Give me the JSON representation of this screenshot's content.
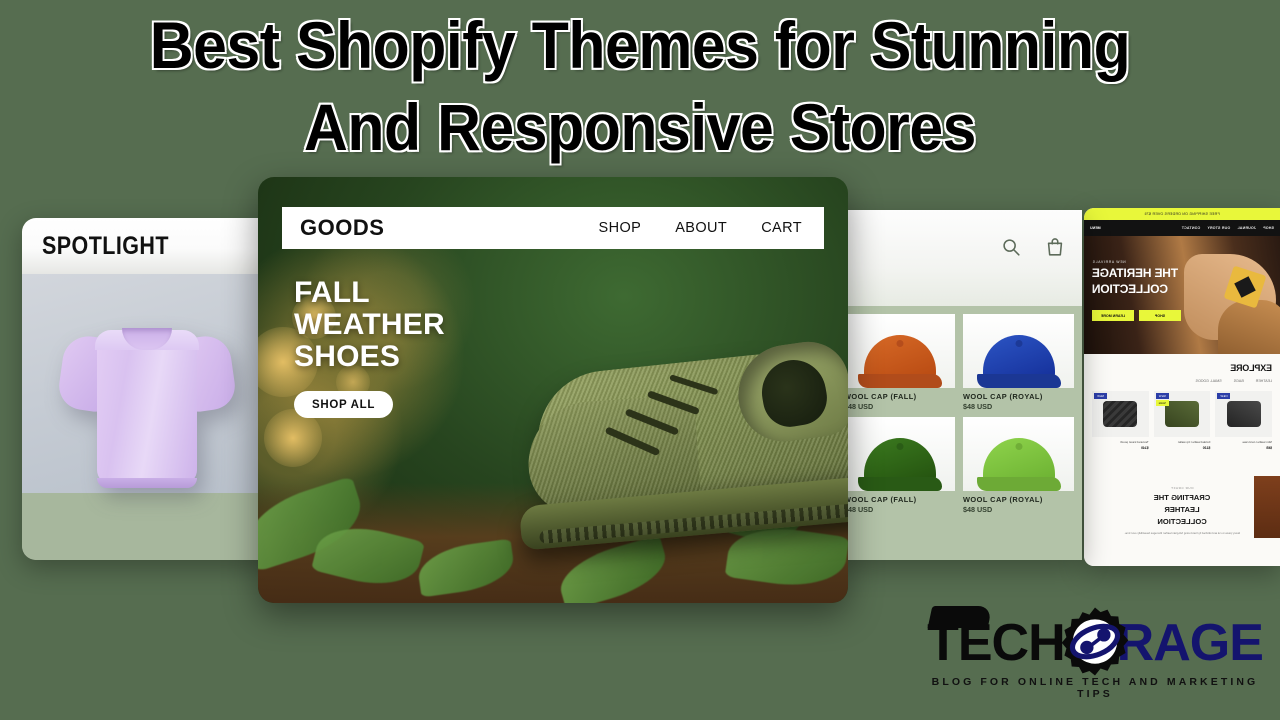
{
  "page": {
    "background_color": "#566d50",
    "title_lines": [
      "Best Shopify Themes for Stunning",
      "And Responsive Stores"
    ]
  },
  "left_card": {
    "name": "spotlight-theme-card",
    "header_label": "SPOTLIGHT",
    "product_alt": "lavender t-shirt",
    "header_bg": "#ffffff",
    "stage_bg": "#c6ccd4",
    "footer_bg": "#a7b79d"
  },
  "center_card": {
    "name": "goods-theme-card",
    "brand": "GOODS",
    "nav": [
      "SHOP",
      "ABOUT",
      "CART"
    ],
    "headline": [
      "FALL",
      "WEATHER",
      "SHOES"
    ],
    "cta": "SHOP ALL",
    "product_alt": "olive green knit sneaker",
    "bg_color": "#27451f"
  },
  "right_card": {
    "name": "wool-cap-grid-card",
    "icons": [
      "search-icon",
      "shopping-bag-icon"
    ],
    "products": [
      {
        "name": "WOOL CAP (FALL)",
        "price": "$48 USD",
        "color": "#c9561f"
      },
      {
        "name": "WOOL CAP (ROYAL)",
        "price": "$48 USD",
        "color": "#1f3fa8"
      },
      {
        "name": "WOOL CAP (FALL)",
        "price": "$48 USD",
        "color": "#2f6618"
      },
      {
        "name": "WOOL CAP (ROYAL)",
        "price": "$48 USD",
        "color": "#7cc13d"
      }
    ],
    "bg_color": "#b3c3a8"
  },
  "far_card": {
    "name": "heritage-theme-card",
    "mirrored": true,
    "announcement": "FREE SHIPPING ON ORDERS OVER $75",
    "nav": [
      "SHOP",
      "JOURNAL",
      "OUR STORY",
      "CONTACT"
    ],
    "nav_right": "MENU",
    "hero_eyebrow": "NEW ARRIVALS",
    "hero_title": [
      "THE HERITAGE",
      "COLLECTION"
    ],
    "hero_buttons": [
      "SHOP",
      "LEARN MORE"
    ],
    "section_title": "EXPLORE",
    "filters": [
      "LEATHER",
      "BAGS",
      "SMALL GOODS"
    ],
    "products": [
      {
        "name": "Slim leather card case",
        "price": "$65",
        "badge": "NEW",
        "badge2": "",
        "color": "#3b3b3b"
      },
      {
        "name": "Folded leather zip wallet",
        "price": "$120",
        "badge": "NEW",
        "badge2": "SALE",
        "color": "#4a5a2e"
      },
      {
        "name": "Textured travel pouch",
        "price": "$140",
        "badge": "NEW",
        "badge2": "",
        "color": "#2e2e2e"
      }
    ],
    "footer_eyebrow": "OUR CRAFT",
    "footer_title": [
      "CRAFTING THE",
      "LEATHER",
      "COLLECTION"
    ],
    "footer_body": "Every piece is cut and stitched by hand using full-grain leather that ages beautifully over time.",
    "accent_color": "#e8f73a"
  },
  "logo": {
    "name": "techorage-logo",
    "text_primary": "TECH",
    "text_secondary": "RAGE",
    "tagline": "BLOG FOR ONLINE TECH AND MARKETING TIPS",
    "primary_color": "#0a0a0a",
    "secondary_color": "#14146e"
  }
}
